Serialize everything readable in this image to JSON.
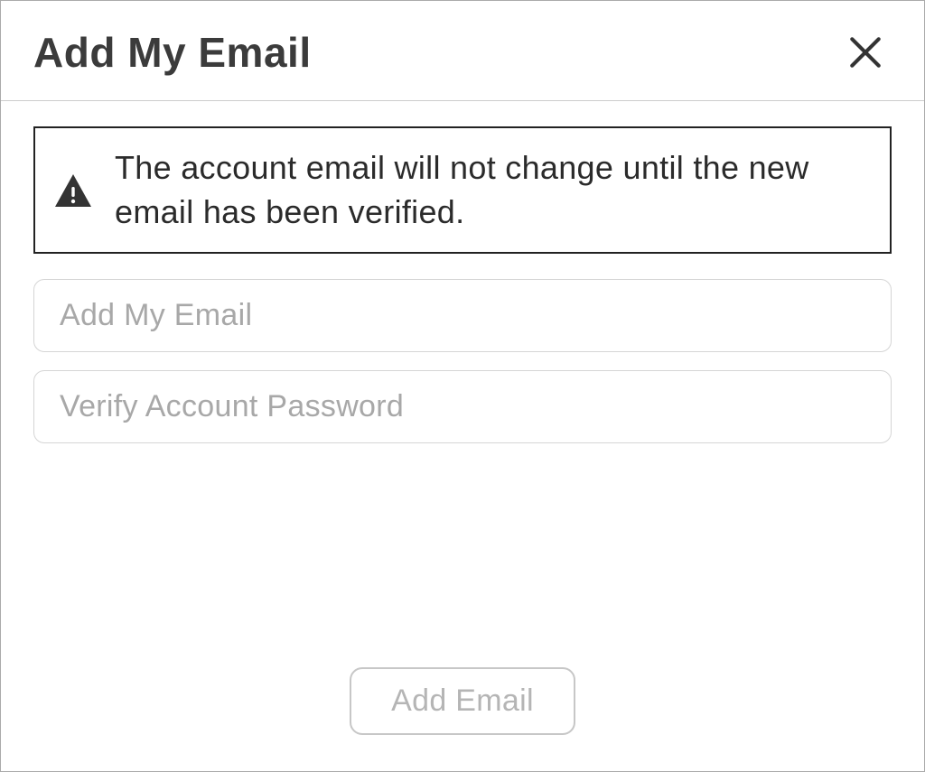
{
  "dialog": {
    "title": "Add My Email",
    "warning_message": "The account email will not change until the new email has been verified.",
    "email_input": {
      "placeholder": "Add My Email",
      "value": ""
    },
    "password_input": {
      "placeholder": "Verify Account Password",
      "value": ""
    },
    "submit_label": "Add Email"
  }
}
